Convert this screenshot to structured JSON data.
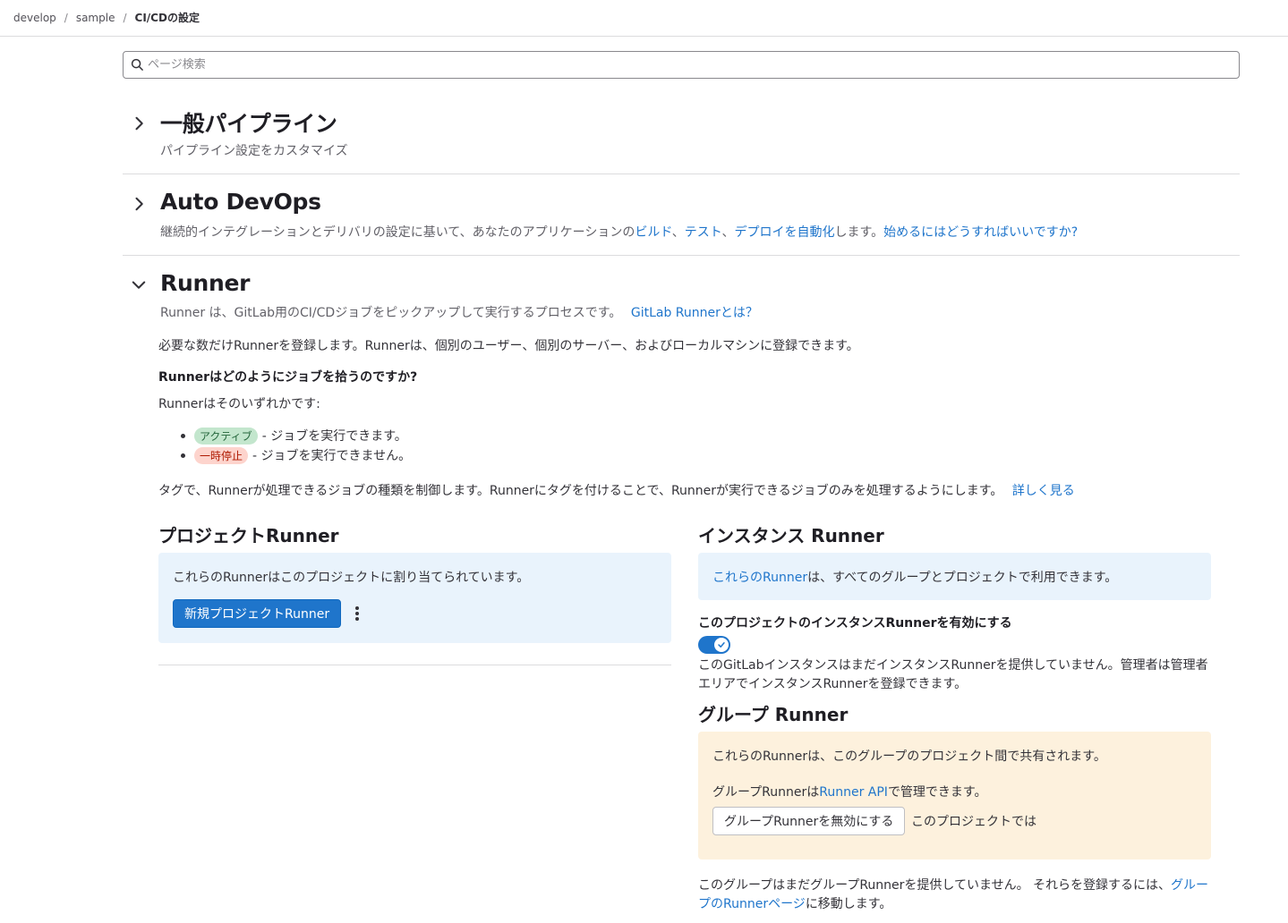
{
  "breadcrumb": {
    "items": [
      "develop",
      "sample"
    ],
    "current": "CI/CDの設定",
    "separator": "/"
  },
  "search": {
    "placeholder": "ページ検索"
  },
  "sections": {
    "general": {
      "title": "一般パイプライン",
      "description": "パイプライン設定をカスタマイズ"
    },
    "autodevops": {
      "title": "Auto DevOps",
      "desc_prefix": "継続的インテグレーションとデリバリの設定に基いて、あなたのアプリケーションの",
      "link_build": "ビルド",
      "comma1": "、",
      "link_test": "テスト",
      "comma2": "、",
      "link_deploy": "デプロイを自動化",
      "desc_suffix": "します。",
      "link_getting_started": "始めるにはどうすればいいですか?"
    },
    "runner": {
      "title": "Runner",
      "description": "Runner は、GitLab用のCI/CDジョブをピックアップして実行するプロセスです。",
      "link_what": "GitLab Runnerとは？"
    }
  },
  "runner_body": {
    "intro": "必要な数だけRunnerを登録します。Runnerは、個別のユーザー、個別のサーバー、およびローカルマシンに登録できます。",
    "how_title": "Runnerはどのようにジョブを拾うのですか?",
    "either": "Runnerはそのいずれかです:",
    "states": [
      {
        "badge": "アクティブ",
        "text": "- ジョブを実行できます。"
      },
      {
        "badge": "一時停止",
        "text": "- ジョブを実行できません。"
      }
    ],
    "tags_text": "タグで、Runnerが処理できるジョブの種類を制御します。Runnerにタグを付けることで、Runnerが実行できるジョブのみを処理するようにします。",
    "tags_link": "詳しく見る"
  },
  "project_runner": {
    "title": "プロジェクトRunner",
    "assigned_text": "これらのRunnerはこのプロジェクトに割り当てられています。",
    "new_button": "新規プロジェクトRunner"
  },
  "instance_runner": {
    "title": "インスタンス Runner",
    "info_link": "これらのRunner",
    "info_text": "は、すべてのグループとプロジェクトで利用できます。",
    "toggle_label": "このプロジェクトのインスタンスRunnerを有効にする",
    "toggle_on": true,
    "note_line1": "このGitLabインスタンスはまだインスタンスRunnerを提供していません。管理者は管理者",
    "note_line2": "エリアでインスタンスRunnerを登録できます。"
  },
  "group_runner": {
    "title": "グループ Runner",
    "shared_text": "これらのRunnerは、このグループのプロジェクト間で共有されます。",
    "api_prefix": "グループRunnerは",
    "api_link": "Runner API",
    "api_suffix": "で管理できます。",
    "disable_button": "グループRunnerを無効にする",
    "disable_suffix": "このプロジェクトでは",
    "empty_line1_text": "このグループはまだグループRunnerを提供していません。 それらを登録するには、",
    "empty_link_part1": "グルー",
    "empty_link_part2": "プのRunnerページ",
    "empty_line2_suffix": "に移動します。"
  },
  "colors": {
    "link": "#1f75cb",
    "primary": "#1f75cb",
    "info_bg": "#e9f3fc",
    "warning_bg": "#fdf1dd"
  }
}
